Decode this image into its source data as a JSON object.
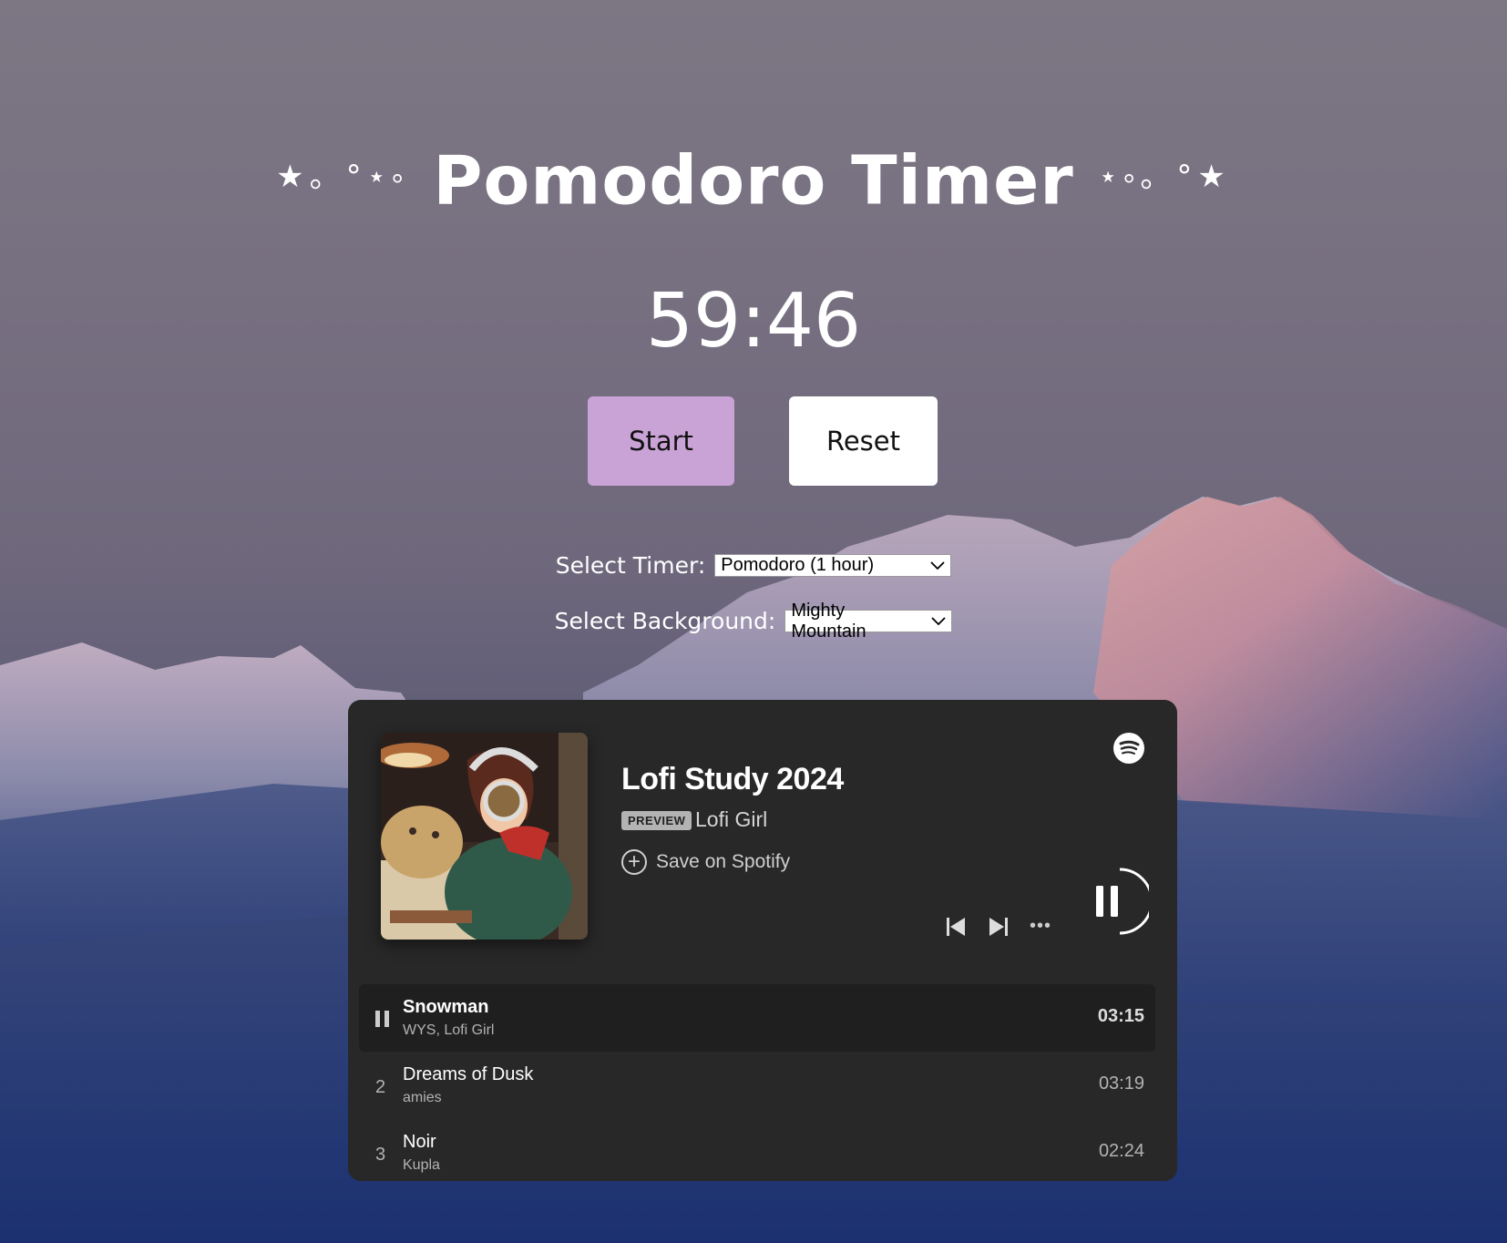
{
  "page": {
    "title_deco_left": "★。°⋆༚",
    "title": "Pomodoro Timer",
    "title_deco_right": "⋆༚。°★"
  },
  "timer": {
    "display": "59:46"
  },
  "controls": {
    "start_label": "Start",
    "reset_label": "Reset"
  },
  "selectors": {
    "timer_label": "Select Timer:",
    "timer_value": "Pomodoro (1 hour)",
    "background_label": "Select Background:",
    "background_value": "Mighty Mountain"
  },
  "player": {
    "playlist_title": "Lofi Study 2024",
    "badge": "PREVIEW",
    "artist": "Lofi Girl",
    "save_label": "Save on Spotify",
    "icons": [
      "spotify-icon",
      "previous-icon",
      "next-icon",
      "more-icon",
      "pause-icon"
    ],
    "tracks": [
      {
        "index": "",
        "name": "Snowman",
        "artist": "WYS, Lofi Girl",
        "duration": "03:15",
        "playing": true
      },
      {
        "index": "2",
        "name": "Dreams of Dusk",
        "artist": "amies",
        "duration": "03:19",
        "playing": false
      },
      {
        "index": "3",
        "name": "Noir",
        "artist": "Kupla",
        "duration": "02:24",
        "playing": false
      }
    ]
  },
  "colors": {
    "start_button": "#c9a2d6",
    "reset_button": "#ffffff",
    "player_bg": "#282828"
  }
}
